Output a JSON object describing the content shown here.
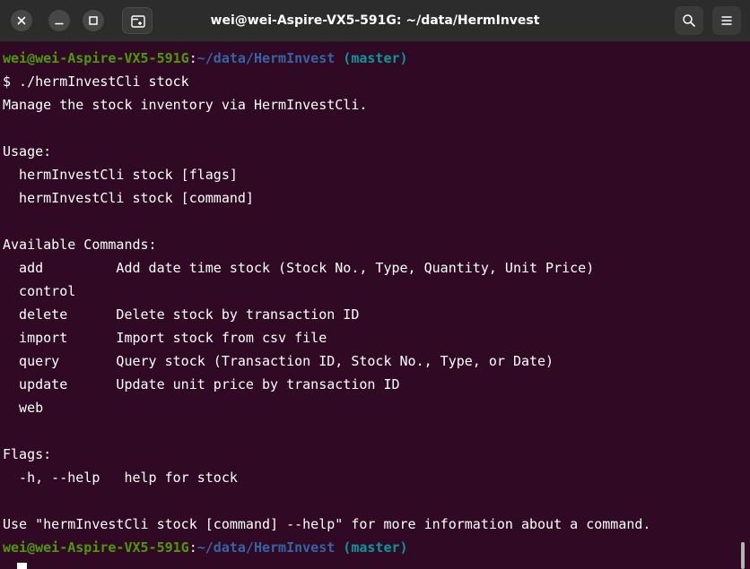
{
  "window": {
    "title": "wei@wei-Aspire-VX5-591G: ~/data/HermInvest",
    "controls": [
      "close-icon",
      "minimize-icon",
      "maximize-icon"
    ],
    "header_buttons": [
      "new-tab-icon",
      "search-icon",
      "hamburger-menu-icon"
    ]
  },
  "terminal": {
    "prompt": {
      "user_host": "wei@wei-Aspire-VX5-591G",
      "sep": ":",
      "path": "~/data/HermInvest",
      "branch": " (master)"
    },
    "lines": [
      "$ ./hermInvestCli stock",
      "Manage the stock inventory via HermInvestCli.",
      "",
      "Usage:",
      "  hermInvestCli stock [flags]",
      "  hermInvestCli stock [command]",
      "",
      "Available Commands:",
      "  add         Add date time stock (Stock No., Type, Quantity, Unit Price)",
      "  control",
      "  delete      Delete stock by transaction ID",
      "  import      Import stock from csv file",
      "  query       Query stock (Transaction ID, Stock No., Type, or Date)",
      "  update      Update unit price by transaction ID",
      "  web",
      "",
      "Flags:",
      "  -h, --help   help for stock",
      "",
      "Use \"hermInvestCli stock [command] --help\" for more information about a command."
    ]
  },
  "colors": {
    "background": "#300a24",
    "titlebar": "#2c2c2c",
    "prompt_user": "#4e9a06",
    "prompt_path": "#3465a4",
    "prompt_branch": "#06989a",
    "text": "#ffffff"
  }
}
